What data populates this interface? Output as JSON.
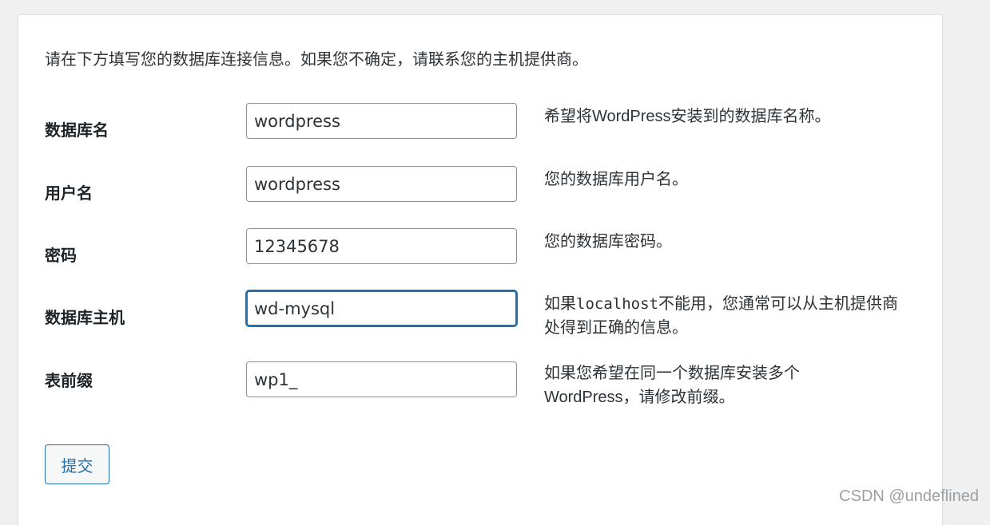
{
  "intro": "请在下方填写您的数据库连接信息。如果您不确定，请联系您的主机提供商。",
  "fields": [
    {
      "label": "数据库名",
      "value": "wordpress",
      "desc": "希望将WordPress安装到的数据库名称。"
    },
    {
      "label": "用户名",
      "value": "wordpress",
      "desc": "您的数据库用户名。"
    },
    {
      "label": "密码",
      "value": "12345678",
      "desc": "您的数据库密码。"
    },
    {
      "label": "数据库主机",
      "value": "wd-mysql",
      "desc_before": "如果",
      "desc_code": "localhost",
      "desc_after": "不能用，您通常可以从主机提供商处得到正确的信息。"
    },
    {
      "label": "表前缀",
      "value": "wp1_",
      "desc": "如果您希望在同一个数据库安装多个WordPress，请修改前缀。"
    }
  ],
  "submit_label": "提交",
  "watermark": "CSDN @undeflined",
  "colors": {
    "page_background": "#f0f0f1",
    "card_background": "#ffffff",
    "accent": "#2271b1",
    "input_border": "#8c8f94"
  }
}
